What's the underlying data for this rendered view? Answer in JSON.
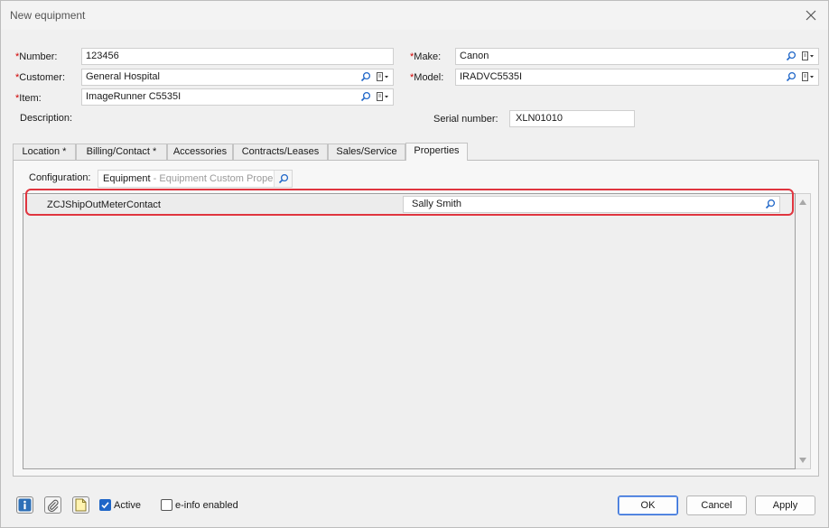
{
  "window": {
    "title": "New equipment"
  },
  "form": {
    "number": {
      "label": "Number:",
      "value": "123456"
    },
    "customer": {
      "label": "Customer:",
      "value": "General Hospital"
    },
    "item": {
      "label": "Item:",
      "value": "ImageRunner C5535I"
    },
    "description": {
      "label": "Description:"
    },
    "make": {
      "label": "Make:",
      "value": "Canon"
    },
    "model": {
      "label": "Model:",
      "value": "IRADVC5535I"
    },
    "serial": {
      "label": "Serial number:",
      "value": "XLN01010"
    },
    "required_mark": "*"
  },
  "tabs": [
    {
      "label": "Location *"
    },
    {
      "label": "Billing/Contact *"
    },
    {
      "label": "Accessories"
    },
    {
      "label": "Contracts/Leases"
    },
    {
      "label": "Sales/Service"
    },
    {
      "label": "Properties"
    }
  ],
  "active_tab": "Properties",
  "properties": {
    "configuration_label": "Configuration:",
    "configuration_value": "Equipment",
    "configuration_hint": " - Equipment Custom Properti",
    "rows": [
      {
        "name": "ZCJShipOutMeterContact",
        "value": "Sally Smith"
      }
    ]
  },
  "footer": {
    "active_label": "Active",
    "active_checked": true,
    "einfo_label": "e-info enabled",
    "einfo_checked": false,
    "ok_label": "OK",
    "cancel_label": "Cancel",
    "apply_label": "Apply"
  },
  "colors": {
    "accent": "#1f66c8",
    "highlight": "#e0353f"
  },
  "icons": [
    "close-icon",
    "search-icon",
    "browse-dropdown-icon",
    "info-icon",
    "attachment-icon",
    "note-icon",
    "scroll-up-arrow-icon",
    "scroll-down-arrow-icon"
  ]
}
